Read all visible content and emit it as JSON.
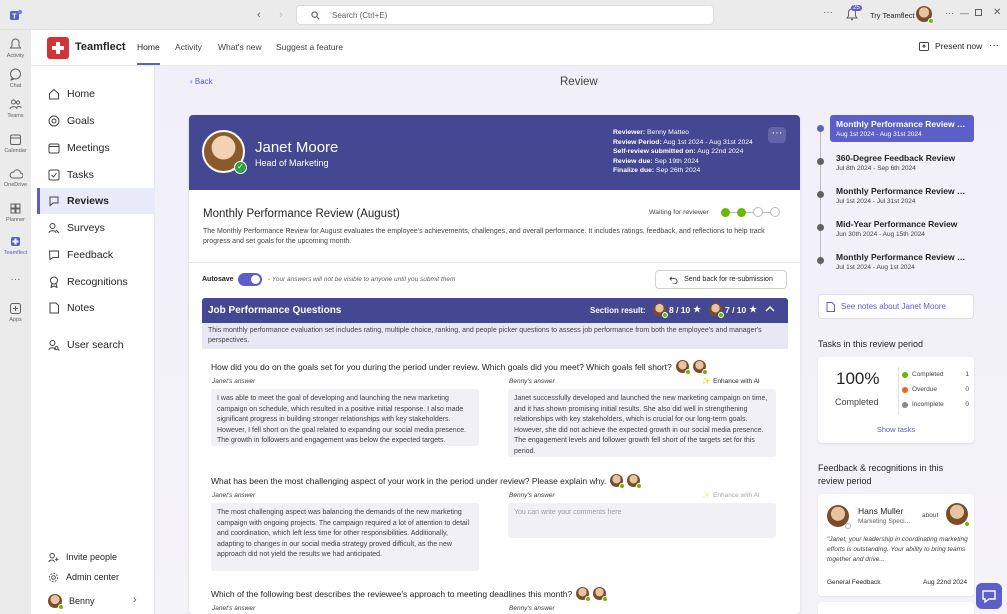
{
  "topbar": {
    "search_placeholder": "Search (Ctrl+E)",
    "notification_count": "25",
    "profile_label": "Try Teamflect"
  },
  "rail": [
    {
      "label": "Activity"
    },
    {
      "label": "Chat"
    },
    {
      "label": "Teams"
    },
    {
      "label": "Calendar"
    },
    {
      "label": "OneDrive"
    },
    {
      "label": "Planner"
    },
    {
      "label": "Teamflect"
    },
    {
      "label": "Apps"
    }
  ],
  "app": {
    "brand": "Teamflect",
    "tabs": [
      "Home",
      "Activity",
      "What's new",
      "Suggest a feature"
    ],
    "present_label": "Present now"
  },
  "sidebar": {
    "items": [
      "Home",
      "Goals",
      "Meetings",
      "Tasks",
      "Reviews",
      "Surveys",
      "Feedback",
      "Recognitions",
      "Notes",
      "User search"
    ],
    "bottom": [
      "Invite people",
      "Admin center"
    ],
    "user_name": "Benny"
  },
  "page": {
    "back_label": "Back",
    "title": "Review"
  },
  "review": {
    "employee_name": "Janet Moore",
    "employee_role": "Head of Marketing",
    "meta": [
      {
        "label": "Reviewer:",
        "value": " Benny Matteo"
      },
      {
        "label": "Review Period:",
        "value": " Aug 1st 2024 - Aug 31st 2024"
      },
      {
        "label": "Self-review submitted on:",
        "value": " Aug 22nd 2024"
      },
      {
        "label": "Review due:",
        "value": " Sep 19th 2024"
      },
      {
        "label": "Finalize due:",
        "value": " Sep 26th 2024"
      }
    ],
    "title": "Monthly Performance Review (August)",
    "status_label": "Waiting for reviewer",
    "description": "The Monthly Performance Review for August evaluates the employee's achievements, challenges, and overall performance. It includes ratings, feedback, and reflections to help track progress and set goals for the upcoming month.",
    "autosave_label": "Autosave",
    "autosave_note": "- Your answers will not be visible to anyone until you submit them",
    "send_back_label": "Send back for re-submission",
    "section": {
      "title": "Job Performance Questions",
      "result_label": "Section result:",
      "score1": "8 / 10",
      "score2": "7 / 10",
      "description": "This monthly performance evaluation set includes rating, multiple choice, ranking, and people picker questions to assess job performance from both the employee's and manager's perspectives."
    },
    "answer_label_self": "Janet's answer",
    "answer_label_reviewer": "Benny's answer",
    "enhance_label": "Enhance with AI",
    "questions": [
      {
        "text": "How did you do on the goals set for you during the period under review. Which goals did you meet? Which goals fell short?",
        "self_answer": "I was able to meet the goal of developing and launching the new marketing campaign on schedule, which resulted in a positive initial response. I also made significant progress in building stronger relationships with key stakeholders. However, I fell short on the goal related to expanding our social media presence. The growth in followers and engagement was below the expected targets.",
        "reviewer_answer": "Janet successfully developed and launched the new marketing campaign on time, and it has shown promising initial results. She also did well in strengthening relationships with key stakeholders, which is crucial for our long-term goals. However, she did not achieve the expected growth in our social media presence. The engagement levels and follower growth fell short of the targets set for this period."
      },
      {
        "text": "What has been the most challenging aspect of your work in the period under review? Please explain why.",
        "self_answer": "The most challenging aspect was balancing the demands of the new marketing campaign with ongoing projects. The campaign required a lot of attention to detail and coordination, which left less time for other responsibilities. Additionally, adapting to changes in our social media strategy proved difficult, as the new approach did not yield the results we had anticipated.",
        "reviewer_placeholder": "You can write your comments here"
      },
      {
        "text": "Which of the following best describes the reviewee's approach to meeting deadlines this month?"
      }
    ]
  },
  "timeline": [
    {
      "title": "Monthly Performance Review (A...",
      "dates": "Aug 1st 2024 - Aug 31st 2024"
    },
    {
      "title": "360-Degree Feedback Review",
      "dates": "Jul 8th 2024 - Sep 6th 2024"
    },
    {
      "title": "Monthly Performance Review (Jul...",
      "dates": "Jul 1st 2024 - Jul 31st 2024"
    },
    {
      "title": "Mid-Year Performance Review",
      "dates": "Jun 30th 2024 - Aug 15th 2024"
    },
    {
      "title": "Monthly Performance Review (Ju...",
      "dates": "Jul 1st 2024 - Aug 1st 2024"
    }
  ],
  "notes_link": "See notes about Janet Moore",
  "tasks": {
    "header": "Tasks in this review period",
    "percent": "100%",
    "percent_label": "Completed",
    "legend": [
      {
        "label": "Completed",
        "count": "1",
        "color": "#6bb700"
      },
      {
        "label": "Overdue",
        "count": "0",
        "color": "#f7630c"
      },
      {
        "label": "Incomplete",
        "count": "0",
        "color": "#8a8a8a"
      }
    ],
    "show_tasks": "Show tasks"
  },
  "feedback": {
    "header": "Feedback & recognitions in this review period",
    "card": {
      "name": "Hans Muller",
      "role": "Marketing Speci...",
      "about": "about",
      "quote": "\"Janet, your leadership in coordinating marketing efforts is outstanding. Your ability to bring teams together and drive...",
      "type": "General Feedback",
      "date": "Aug 22nd 2024"
    }
  },
  "colors": {
    "accent": "#5b5fc7",
    "banner": "#444791",
    "success": "#6bb700"
  }
}
